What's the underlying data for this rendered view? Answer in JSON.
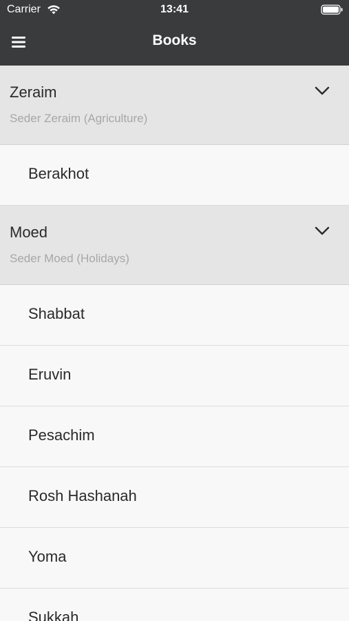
{
  "status_bar": {
    "carrier": "Carrier",
    "time": "13:41"
  },
  "nav": {
    "title": "Books",
    "menu_icon": "hamburger-menu-icon"
  },
  "sections": [
    {
      "title": "Zeraim",
      "subtitle": "Seder Zeraim (Agriculture)",
      "expanded": true,
      "books": [
        "Berakhot"
      ]
    },
    {
      "title": "Moed",
      "subtitle": "Seder Moed (Holidays)",
      "expanded": true,
      "books": [
        "Shabbat",
        "Eruvin",
        "Pesachim",
        "Rosh Hashanah",
        "Yoma",
        "Sukkah"
      ]
    }
  ],
  "colors": {
    "nav_background": "#3a3b3d",
    "section_background": "#e5e5e5",
    "row_background": "#f8f8f8"
  }
}
